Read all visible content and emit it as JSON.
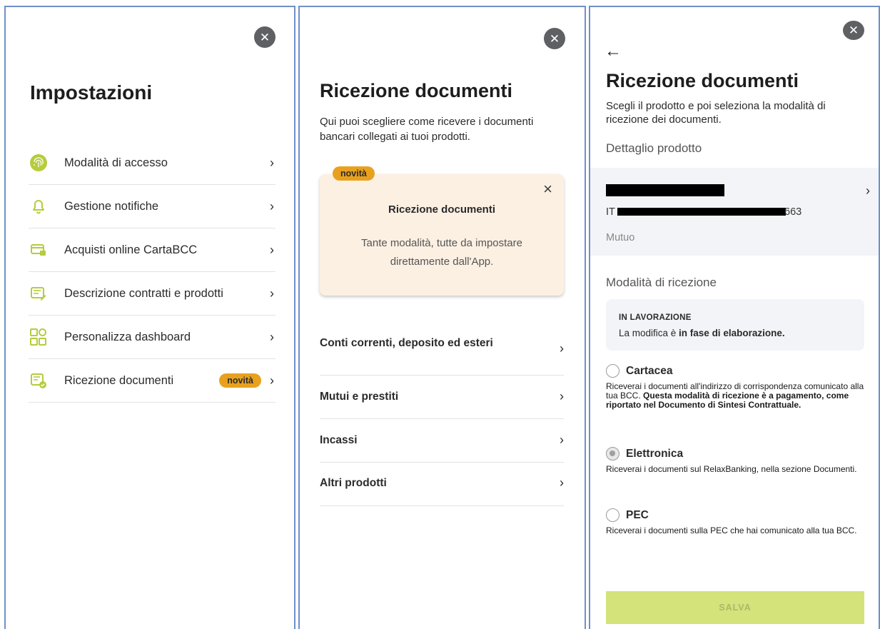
{
  "screen1": {
    "close_icon": "close-icon",
    "title": "Impostazioni",
    "items": [
      {
        "label": "Modalità di accesso",
        "icon": "fingerprint-icon"
      },
      {
        "label": "Gestione notifiche",
        "icon": "bell-icon"
      },
      {
        "label": "Acquisti online CartaBCC",
        "icon": "card-lock-icon"
      },
      {
        "label": "Descrizione contratti e prodotti",
        "icon": "document-edit-icon"
      },
      {
        "label": "Personalizza dashboard",
        "icon": "dashboard-icon"
      },
      {
        "label": "Ricezione documenti",
        "icon": "document-check-icon",
        "badge": "novità"
      }
    ]
  },
  "screen2": {
    "title": "Ricezione documenti",
    "description": "Qui puoi scegliere come ricevere i documenti bancari collegati ai tuoi prodotti.",
    "promo": {
      "badge": "novità",
      "title": "Ricezione documenti",
      "text": "Tante modalità, tutte da impostare direttamente dall'App."
    },
    "items": [
      {
        "label": "Conti correnti, deposito ed esteri"
      },
      {
        "label": "Mutui e prestiti"
      },
      {
        "label": "Incassi"
      },
      {
        "label": "Altri prodotti"
      }
    ]
  },
  "screen3": {
    "back_icon": "arrow-left-icon",
    "title": "Ricezione documenti",
    "description": "Scegli il prodotto e poi seleziona la modalità di ricezione dei documenti.",
    "product_section_label": "Dettaglio prodotto",
    "product": {
      "iban_prefix": "IT",
      "iban_suffix": "663",
      "type": "Mutuo"
    },
    "reception_section_label": "Modalità di ricezione",
    "status": {
      "title": "IN LAVORAZIONE",
      "text_prefix": "La modifica è ",
      "text_bold": "in fase di elaborazione."
    },
    "options": [
      {
        "label": "Cartacea",
        "selected": false,
        "desc": "Riceverai i documenti all'indirizzo di corrispondenza comunicato alla tua BCC. ",
        "desc_bold": "Questa modalità di ricezione è a pagamento, come riportato nel Documento di Sintesi Contrattuale."
      },
      {
        "label": "Elettronica",
        "selected": true,
        "desc": "Riceverai i documenti sul RelaxBanking, nella sezione Documenti.",
        "desc_bold": ""
      },
      {
        "label": "PEC",
        "selected": false,
        "desc": "Riceverai i documenti sulla PEC che hai comunicato alla tua BCC.",
        "desc_bold": ""
      }
    ],
    "save_label": "SALVA"
  },
  "colors": {
    "badge": "#e8a11e",
    "icon_green": "#b6cc3c",
    "save_button": "#d4e37a",
    "panel_border": "#6f8fc9"
  }
}
